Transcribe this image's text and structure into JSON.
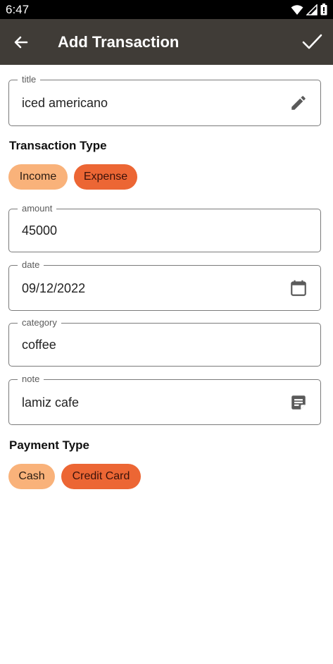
{
  "status_bar": {
    "time": "6:47",
    "icons": [
      "wifi-icon",
      "signal-icon",
      "battery-icon"
    ]
  },
  "app_bar": {
    "title": "Add Transaction",
    "back_icon": "arrow-back-icon",
    "confirm_icon": "check-icon"
  },
  "fields": {
    "title": {
      "label": "title",
      "value": "iced americano",
      "icon": "edit-pencil-icon"
    },
    "amount": {
      "label": "amount",
      "value": "45000"
    },
    "date": {
      "label": "date",
      "value": "09/12/2022",
      "icon": "calendar-icon"
    },
    "category": {
      "label": "category",
      "value": "coffee"
    },
    "note": {
      "label": "note",
      "value": "lamiz cafe",
      "icon": "note-icon"
    }
  },
  "transaction_type": {
    "heading": "Transaction Type",
    "options": [
      "Income",
      "Expense"
    ]
  },
  "payment_type": {
    "heading": "Payment Type",
    "options": [
      "Cash",
      "Credit Card"
    ]
  },
  "colors": {
    "app_bar": "#403c37",
    "chip_light": "#f9b27a",
    "chip_dark": "#ec6634"
  }
}
